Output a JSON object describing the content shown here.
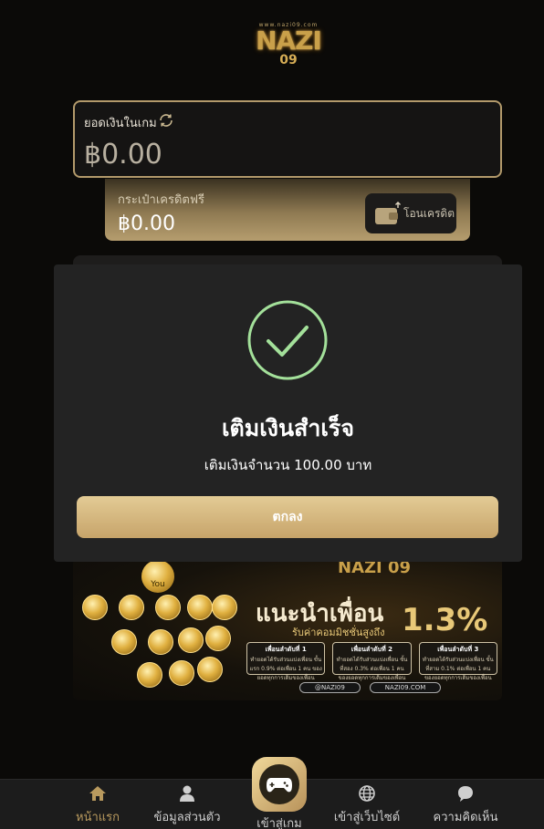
{
  "header": {
    "logo_small": "www.nazi09.com",
    "logo_text": "NAZI",
    "logo_sub": "09"
  },
  "balance": {
    "label": "ยอดเงินในเกม",
    "amount": "฿0.00"
  },
  "credit": {
    "label": "กระเป๋าเครดิตฟรี",
    "amount": "฿0.00",
    "transfer_label": "โอนเครดิต"
  },
  "banner": {
    "you_label": "You",
    "mini_logo": "NAZI 09",
    "title": "แนะนำเพื่อน",
    "percent": "1.3%",
    "subtitle": "รับค่าคอมมิชชั่นสูงถึง",
    "boxes": [
      {
        "heading": "เพื่อนลำดับที่ 1",
        "text": "ทำยอดได้รับส่วนแบ่งเพื่อน ขั้นแรก 0.9% ต่อเพื่อน 1 คน ของยอดทุกการเดิมของเพื่อน"
      },
      {
        "heading": "เพื่อนลำดับที่ 2",
        "text": "ทำยอดได้รับส่วนแบ่งเพื่อน ขั้นที่สอง 0.3% ต่อเพื่อน 1 คน ของยอดทุกการเดิมของเพื่อน"
      },
      {
        "heading": "เพื่อนลำดับที่ 3",
        "text": "ทำยอดได้รับส่วนแบ่งเพื่อน ขั้นที่สาม 0.1% ต่อเพื่อน 1 คน ของยอดทุกการเดิมของเพื่อน"
      }
    ],
    "links": [
      "@NAZI09",
      "NAZI09.COM"
    ]
  },
  "modal": {
    "title": "เติมเงินสำเร็จ",
    "message": "เติมเงินจำนวน 100.00 บาท",
    "ok_label": "ตกลง",
    "success_color": "#a3e09a"
  },
  "nav": {
    "items": [
      {
        "label": "หน้าแรก",
        "icon": "home-icon",
        "active": true
      },
      {
        "label": "ข้อมูลส่วนตัว",
        "icon": "user-icon",
        "active": false
      },
      {
        "label": "เข้าสู่เกม",
        "icon": "gamepad-icon",
        "active": false
      },
      {
        "label": "เข้าสู่เว็บไซต์",
        "icon": "globe-icon",
        "active": false
      },
      {
        "label": "ความคิดเห็น",
        "icon": "chat-icon",
        "active": false
      }
    ]
  },
  "colors": {
    "gold": "#c7a46a",
    "active_nav": "#b99a5e",
    "modal_bg": "#232323"
  }
}
